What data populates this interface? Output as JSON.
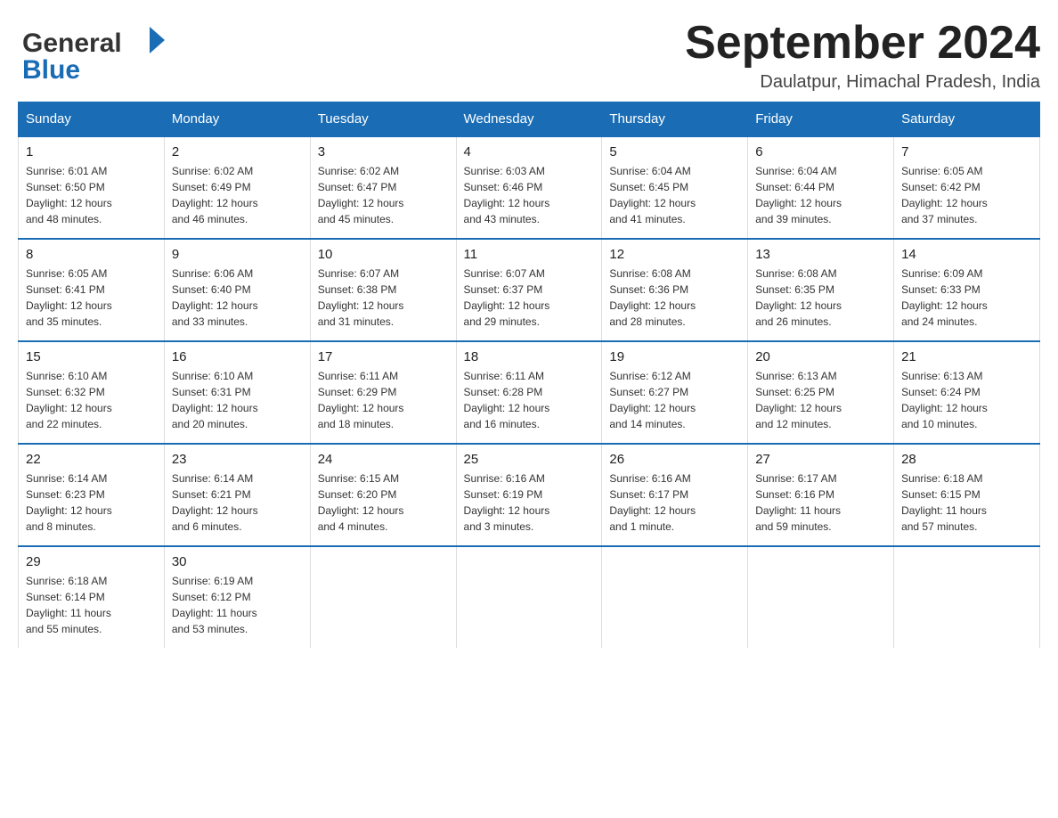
{
  "header": {
    "month_title": "September 2024",
    "location": "Daulatpur, Himachal Pradesh, India",
    "logo_general": "General",
    "logo_blue": "Blue"
  },
  "days_of_week": [
    "Sunday",
    "Monday",
    "Tuesday",
    "Wednesday",
    "Thursday",
    "Friday",
    "Saturday"
  ],
  "weeks": [
    [
      {
        "day": "1",
        "sunrise": "6:01 AM",
        "sunset": "6:50 PM",
        "daylight": "12 hours and 48 minutes."
      },
      {
        "day": "2",
        "sunrise": "6:02 AM",
        "sunset": "6:49 PM",
        "daylight": "12 hours and 46 minutes."
      },
      {
        "day": "3",
        "sunrise": "6:02 AM",
        "sunset": "6:47 PM",
        "daylight": "12 hours and 45 minutes."
      },
      {
        "day": "4",
        "sunrise": "6:03 AM",
        "sunset": "6:46 PM",
        "daylight": "12 hours and 43 minutes."
      },
      {
        "day": "5",
        "sunrise": "6:04 AM",
        "sunset": "6:45 PM",
        "daylight": "12 hours and 41 minutes."
      },
      {
        "day": "6",
        "sunrise": "6:04 AM",
        "sunset": "6:44 PM",
        "daylight": "12 hours and 39 minutes."
      },
      {
        "day": "7",
        "sunrise": "6:05 AM",
        "sunset": "6:42 PM",
        "daylight": "12 hours and 37 minutes."
      }
    ],
    [
      {
        "day": "8",
        "sunrise": "6:05 AM",
        "sunset": "6:41 PM",
        "daylight": "12 hours and 35 minutes."
      },
      {
        "day": "9",
        "sunrise": "6:06 AM",
        "sunset": "6:40 PM",
        "daylight": "12 hours and 33 minutes."
      },
      {
        "day": "10",
        "sunrise": "6:07 AM",
        "sunset": "6:38 PM",
        "daylight": "12 hours and 31 minutes."
      },
      {
        "day": "11",
        "sunrise": "6:07 AM",
        "sunset": "6:37 PM",
        "daylight": "12 hours and 29 minutes."
      },
      {
        "day": "12",
        "sunrise": "6:08 AM",
        "sunset": "6:36 PM",
        "daylight": "12 hours and 28 minutes."
      },
      {
        "day": "13",
        "sunrise": "6:08 AM",
        "sunset": "6:35 PM",
        "daylight": "12 hours and 26 minutes."
      },
      {
        "day": "14",
        "sunrise": "6:09 AM",
        "sunset": "6:33 PM",
        "daylight": "12 hours and 24 minutes."
      }
    ],
    [
      {
        "day": "15",
        "sunrise": "6:10 AM",
        "sunset": "6:32 PM",
        "daylight": "12 hours and 22 minutes."
      },
      {
        "day": "16",
        "sunrise": "6:10 AM",
        "sunset": "6:31 PM",
        "daylight": "12 hours and 20 minutes."
      },
      {
        "day": "17",
        "sunrise": "6:11 AM",
        "sunset": "6:29 PM",
        "daylight": "12 hours and 18 minutes."
      },
      {
        "day": "18",
        "sunrise": "6:11 AM",
        "sunset": "6:28 PM",
        "daylight": "12 hours and 16 minutes."
      },
      {
        "day": "19",
        "sunrise": "6:12 AM",
        "sunset": "6:27 PM",
        "daylight": "12 hours and 14 minutes."
      },
      {
        "day": "20",
        "sunrise": "6:13 AM",
        "sunset": "6:25 PM",
        "daylight": "12 hours and 12 minutes."
      },
      {
        "day": "21",
        "sunrise": "6:13 AM",
        "sunset": "6:24 PM",
        "daylight": "12 hours and 10 minutes."
      }
    ],
    [
      {
        "day": "22",
        "sunrise": "6:14 AM",
        "sunset": "6:23 PM",
        "daylight": "12 hours and 8 minutes."
      },
      {
        "day": "23",
        "sunrise": "6:14 AM",
        "sunset": "6:21 PM",
        "daylight": "12 hours and 6 minutes."
      },
      {
        "day": "24",
        "sunrise": "6:15 AM",
        "sunset": "6:20 PM",
        "daylight": "12 hours and 4 minutes."
      },
      {
        "day": "25",
        "sunrise": "6:16 AM",
        "sunset": "6:19 PM",
        "daylight": "12 hours and 3 minutes."
      },
      {
        "day": "26",
        "sunrise": "6:16 AM",
        "sunset": "6:17 PM",
        "daylight": "12 hours and 1 minute."
      },
      {
        "day": "27",
        "sunrise": "6:17 AM",
        "sunset": "6:16 PM",
        "daylight": "11 hours and 59 minutes."
      },
      {
        "day": "28",
        "sunrise": "6:18 AM",
        "sunset": "6:15 PM",
        "daylight": "11 hours and 57 minutes."
      }
    ],
    [
      {
        "day": "29",
        "sunrise": "6:18 AM",
        "sunset": "6:14 PM",
        "daylight": "11 hours and 55 minutes."
      },
      {
        "day": "30",
        "sunrise": "6:19 AM",
        "sunset": "6:12 PM",
        "daylight": "11 hours and 53 minutes."
      },
      null,
      null,
      null,
      null,
      null
    ]
  ],
  "labels": {
    "sunrise": "Sunrise:",
    "sunset": "Sunset:",
    "daylight": "Daylight:"
  }
}
